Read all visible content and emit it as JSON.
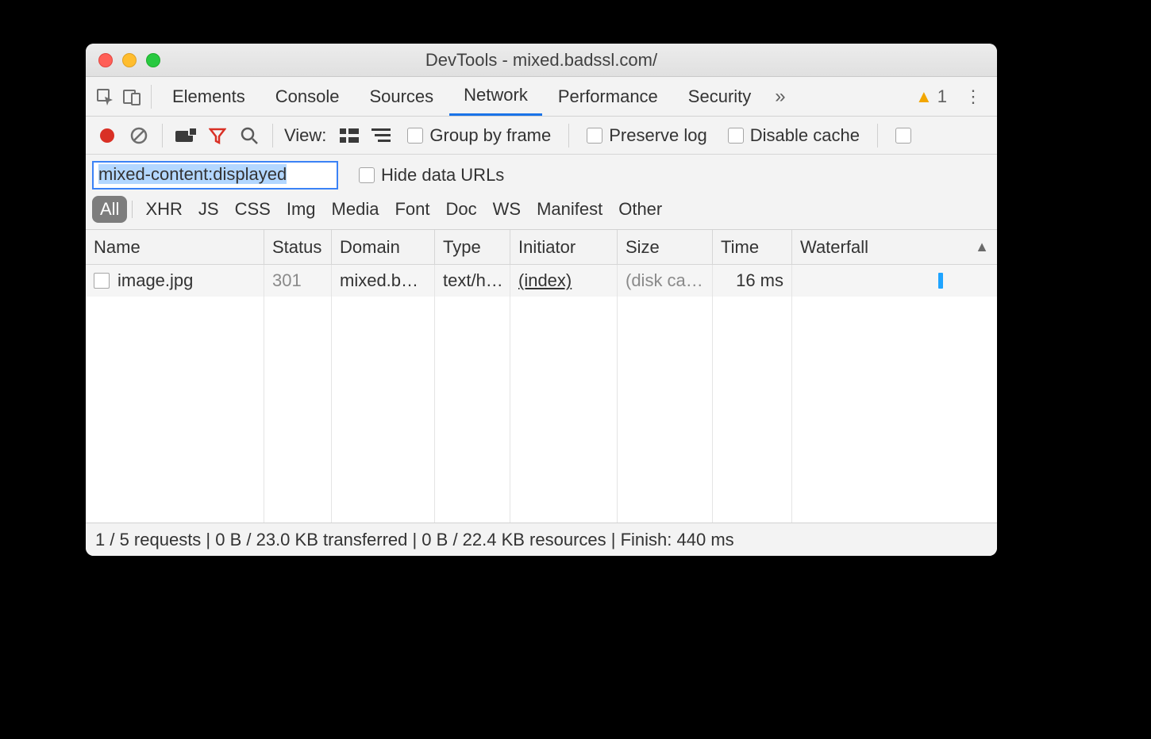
{
  "window": {
    "title": "DevTools - mixed.badssl.com/"
  },
  "tabs": {
    "items": [
      "Elements",
      "Console",
      "Sources",
      "Network",
      "Performance",
      "Security"
    ],
    "active": "Network",
    "warning_count": "1"
  },
  "toolbar": {
    "view_label": "View:",
    "group_by_frame": "Group by frame",
    "preserve_log": "Preserve log",
    "disable_cache": "Disable cache"
  },
  "filter": {
    "value": "mixed-content:displayed",
    "hide_data_urls": "Hide data URLs",
    "chips": [
      "All",
      "XHR",
      "JS",
      "CSS",
      "Img",
      "Media",
      "Font",
      "Doc",
      "WS",
      "Manifest",
      "Other"
    ],
    "active_chip": "All"
  },
  "table": {
    "columns": [
      "Name",
      "Status",
      "Domain",
      "Type",
      "Initiator",
      "Size",
      "Time",
      "Waterfall"
    ],
    "rows": [
      {
        "name": "image.jpg",
        "status": "301",
        "domain": "mixed.b…",
        "type": "text/h…",
        "initiator": "(index)",
        "size": "(disk ca…",
        "time": "16 ms"
      }
    ]
  },
  "status": {
    "text": "1 / 5 requests | 0 B / 23.0 KB transferred | 0 B / 22.4 KB resources | Finish: 440 ms"
  }
}
